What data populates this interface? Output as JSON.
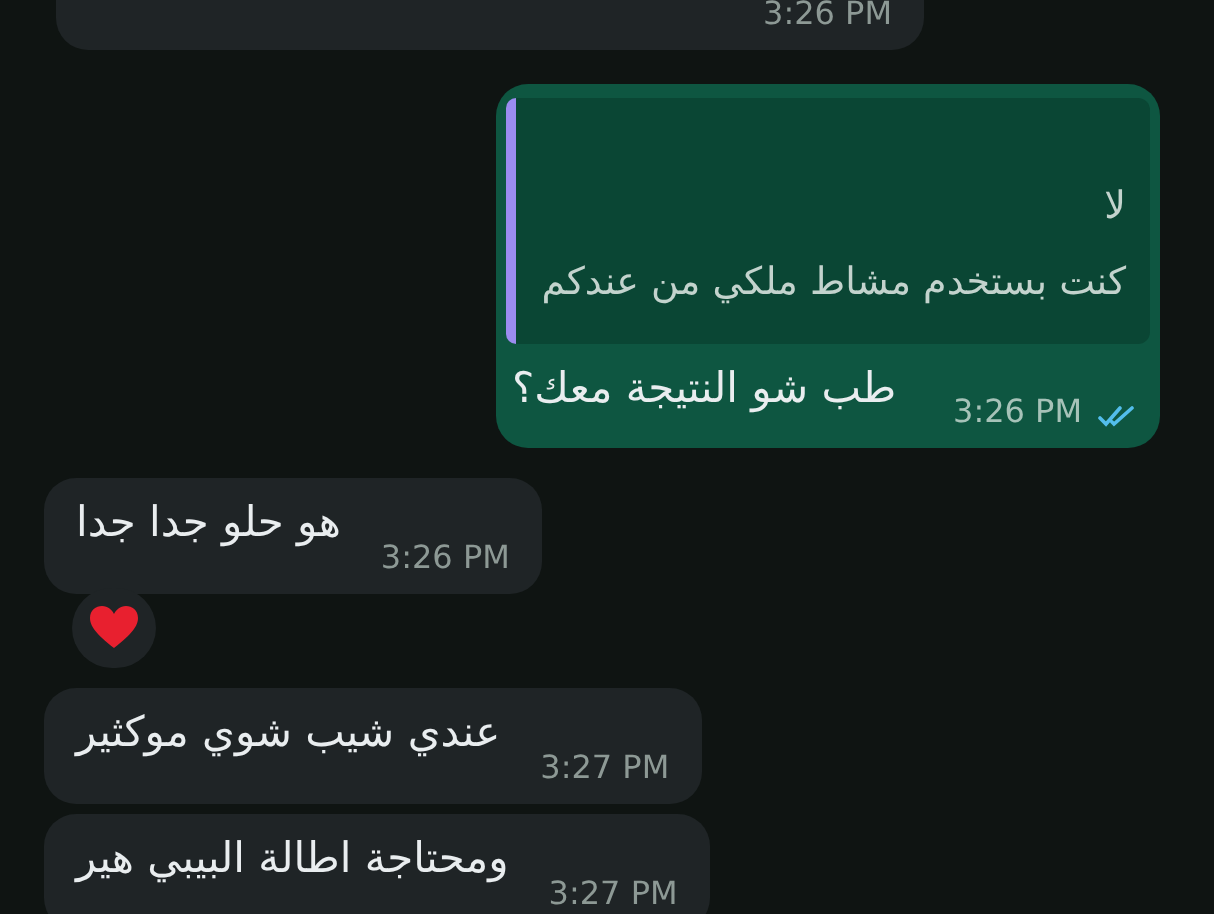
{
  "messages": [
    {
      "kind": "incoming",
      "time": "3:26 PM",
      "reacted": false
    },
    {
      "kind": "outgoing",
      "quote": [
        "لا",
        "كنت بستخدم مشاط ملكي من عندكم"
      ],
      "text": "طب شو النتيجة معك؟",
      "time": "3:26 PM",
      "read": true
    },
    {
      "kind": "incoming",
      "text": "هو حلو جدا جدا",
      "time": "3:26 PM",
      "reacted": true
    },
    {
      "kind": "incoming",
      "text": "عندي شيب شوي موكثير",
      "time": "3:27 PM",
      "reacted": false
    },
    {
      "kind": "incoming",
      "text": "ومحتاجة اطالة البيبي هير",
      "time": "3:27 PM",
      "reacted": false
    }
  ]
}
